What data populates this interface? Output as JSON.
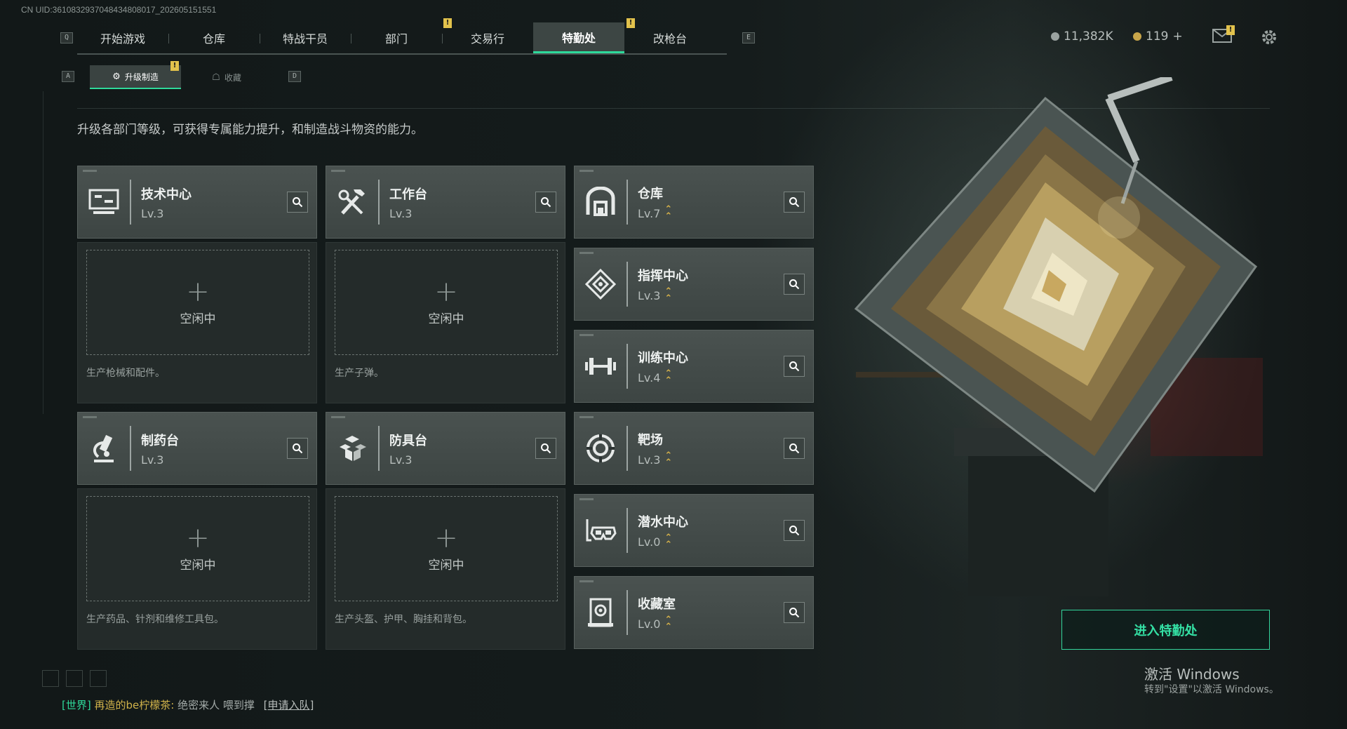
{
  "uid": "CN UID:3610832937048434808017_202605151551",
  "nav": {
    "left_key": "Q",
    "right_key": "E",
    "tabs": [
      {
        "label": "开始游戏",
        "active": false,
        "warn": false
      },
      {
        "label": "仓库",
        "active": false,
        "warn": false
      },
      {
        "label": "特战干员",
        "active": false,
        "warn": false
      },
      {
        "label": "部门",
        "active": false,
        "warn": true
      },
      {
        "label": "交易行",
        "active": false,
        "warn": false
      },
      {
        "label": "特勤处",
        "active": true,
        "warn": true
      },
      {
        "label": "改枪台",
        "active": false,
        "warn": false
      }
    ],
    "warn_mark": "!"
  },
  "subnav": {
    "left_key": "A",
    "right_key": "D",
    "tabs": [
      {
        "label": "升级制造",
        "icon": "⚙",
        "active": true
      },
      {
        "label": "收藏",
        "icon": "☖",
        "active": false
      }
    ]
  },
  "header_right": {
    "currency_silver": "11,382K",
    "currency_gold": "119",
    "plus": "+",
    "silver_color": "#9aa2a0",
    "gold_color": "#c9a64a"
  },
  "description": "升级各部门等级，可获得专属能力提升，和制造战斗物资的能力。",
  "production": [
    {
      "name": "技术中心",
      "lv": "Lv.3",
      "icon": "computer-icon",
      "idle": "空闲中",
      "produce": "生产枪械和配件。"
    },
    {
      "name": "工作台",
      "lv": "Lv.3",
      "icon": "tools-icon",
      "idle": "空闲中",
      "produce": "生产子弹。"
    },
    {
      "name": "制药台",
      "lv": "Lv.3",
      "icon": "microscope-icon",
      "idle": "空闲中",
      "produce": "生产药品、针剂和维修工具包。"
    },
    {
      "name": "防具台",
      "lv": "Lv.3",
      "icon": "armor-blocks-icon",
      "idle": "空闲中",
      "produce": "生产头盔、护甲、胸挂和背包。"
    }
  ],
  "departments": [
    {
      "name": "仓库",
      "lv": "Lv.7",
      "icon": "storage-icon"
    },
    {
      "name": "指挥中心",
      "lv": "Lv.3",
      "icon": "command-diamond-icon"
    },
    {
      "name": "训练中心",
      "lv": "Lv.4",
      "icon": "dumbbell-icon"
    },
    {
      "name": "靶场",
      "lv": "Lv.3",
      "icon": "target-icon"
    },
    {
      "name": "潜水中心",
      "lv": "Lv.0",
      "icon": "diving-mask-icon"
    },
    {
      "name": "收藏室",
      "lv": "Lv.0",
      "icon": "collection-icon"
    }
  ],
  "enter_button": "进入特勤处",
  "windows_activate": {
    "title": "激活 Windows",
    "subtitle": "转到\"设置\"以激活 Windows。"
  },
  "chat": {
    "channel": "[世界]",
    "sender": "再造的be柠檬茶:",
    "message": "绝密来人  喂到撑",
    "link": "[申请入队]"
  },
  "accent_color": "#2ed99a",
  "upgrade_color": "#d9b44a"
}
